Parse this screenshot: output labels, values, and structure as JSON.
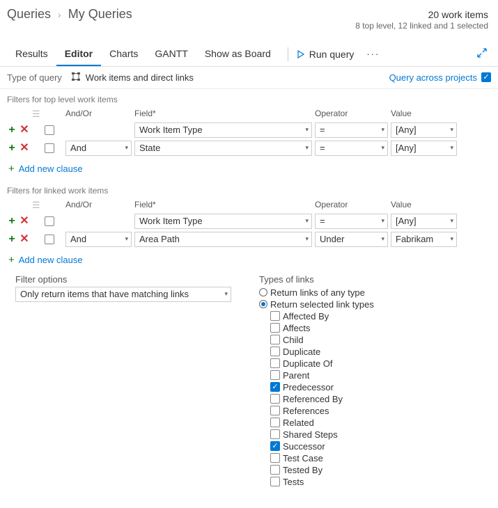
{
  "breadcrumb": {
    "root": "Queries",
    "current": "My Queries"
  },
  "status": {
    "count": "20 work items",
    "detail": "8 top level, 12 linked and 1 selected"
  },
  "tabs": [
    "Results",
    "Editor",
    "Charts",
    "GANTT",
    "Show as Board"
  ],
  "active_tab": 1,
  "actions": {
    "run": "Run query"
  },
  "typeOfQuery": {
    "label": "Type of query",
    "value": "Work items and direct links"
  },
  "queryAcross": {
    "label": "Query across projects",
    "checked": true
  },
  "topFilters": {
    "title": "Filters for top level work items",
    "headers": {
      "andor": "And/Or",
      "field": "Field*",
      "operator": "Operator",
      "value": "Value"
    },
    "rows": [
      {
        "andor": "",
        "field": "Work Item Type",
        "op": "=",
        "val": "[Any]"
      },
      {
        "andor": "And",
        "field": "State",
        "op": "=",
        "val": "[Any]"
      }
    ],
    "add": "Add new clause"
  },
  "linkedFilters": {
    "title": "Filters for linked work items",
    "rows": [
      {
        "andor": "",
        "field": "Work Item Type",
        "op": "=",
        "val": "[Any]"
      },
      {
        "andor": "And",
        "field": "Area Path",
        "op": "Under",
        "val": "Fabrikam"
      }
    ],
    "add": "Add new clause"
  },
  "filterOptions": {
    "label": "Filter options",
    "value": "Only return items that have matching links"
  },
  "linkTypes": {
    "label": "Types of links",
    "radios": [
      {
        "label": "Return links of any type",
        "selected": false
      },
      {
        "label": "Return selected link types",
        "selected": true
      }
    ],
    "items": [
      {
        "label": "Affected By",
        "checked": false
      },
      {
        "label": "Affects",
        "checked": false
      },
      {
        "label": "Child",
        "checked": false
      },
      {
        "label": "Duplicate",
        "checked": false
      },
      {
        "label": "Duplicate Of",
        "checked": false
      },
      {
        "label": "Parent",
        "checked": false
      },
      {
        "label": "Predecessor",
        "checked": true
      },
      {
        "label": "Referenced By",
        "checked": false
      },
      {
        "label": "References",
        "checked": false
      },
      {
        "label": "Related",
        "checked": false
      },
      {
        "label": "Shared Steps",
        "checked": false
      },
      {
        "label": "Successor",
        "checked": true
      },
      {
        "label": "Test Case",
        "checked": false
      },
      {
        "label": "Tested By",
        "checked": false
      },
      {
        "label": "Tests",
        "checked": false
      }
    ]
  }
}
